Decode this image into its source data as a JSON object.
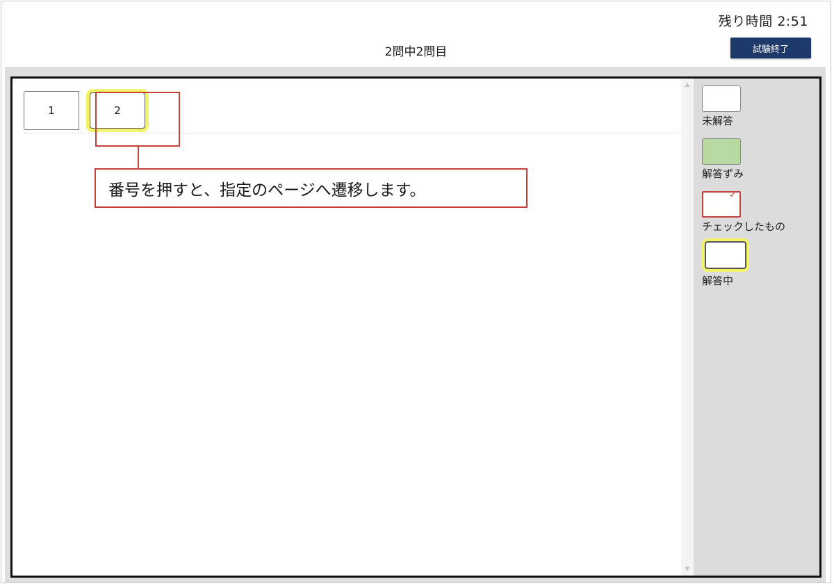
{
  "header": {
    "timer_text": "残り時間 2:51",
    "progress_text": "2問中2問目",
    "finish_button_label": "試験終了"
  },
  "question_tabs": [
    {
      "label": "1",
      "state": "unanswered"
    },
    {
      "label": "2",
      "state": "current"
    }
  ],
  "annotation": {
    "callout_text": "番号を押すと、指定のページへ遷移します。"
  },
  "legend": {
    "unanswered": "未解答",
    "answered": "解答ずみ",
    "checked": "チェックしたもの",
    "current": "解答中"
  },
  "colors": {
    "finish_button": "#1e3a6b",
    "answered": "#b8d9a0",
    "checked_border": "#c4403a",
    "current_highlight": "#f3f36a",
    "annotation_red": "#c4403a"
  },
  "icons": {
    "check_mark": "check-icon",
    "scroll_up": "scroll-up-arrow-icon",
    "scroll_down": "scroll-down-arrow-icon"
  }
}
